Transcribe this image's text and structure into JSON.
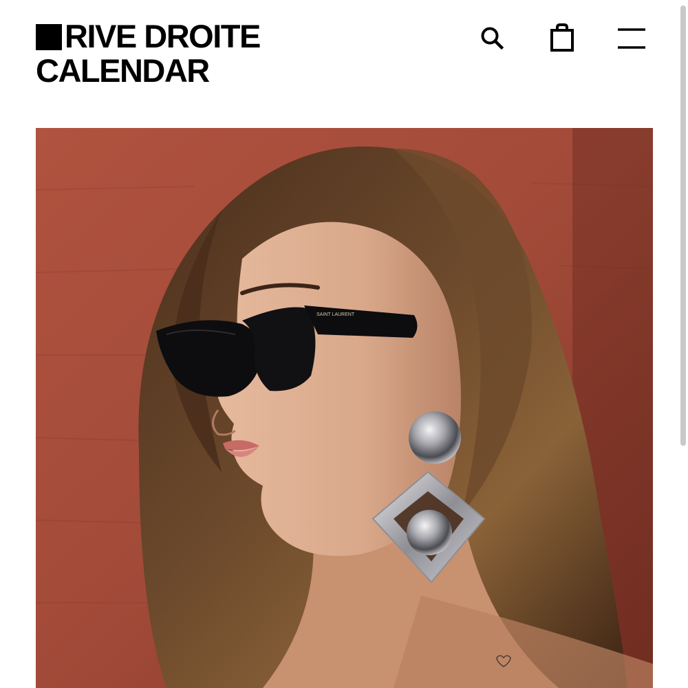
{
  "header": {
    "brand_line1": "RIVE DROITE",
    "brand_line2": "CALENDAR",
    "icons": {
      "search": "search-icon",
      "bag": "shopping-bag-icon",
      "menu": "hamburger-menu-icon"
    }
  },
  "hero": {
    "image_subject": "portrait-woman-sunglasses-earring",
    "sunglasses_brand_text": "SAINT LAURENT",
    "colors": {
      "wall": "#a24a39",
      "hair": "#5a3a22",
      "skin": "#d9a88a",
      "lips": "#d97a78",
      "sunglasses": "#0d0d0f",
      "earring": "#c8c8cc"
    }
  },
  "colors": {
    "text": "#000000",
    "background": "#ffffff",
    "scroll_thumb": "#c9c9c9"
  }
}
